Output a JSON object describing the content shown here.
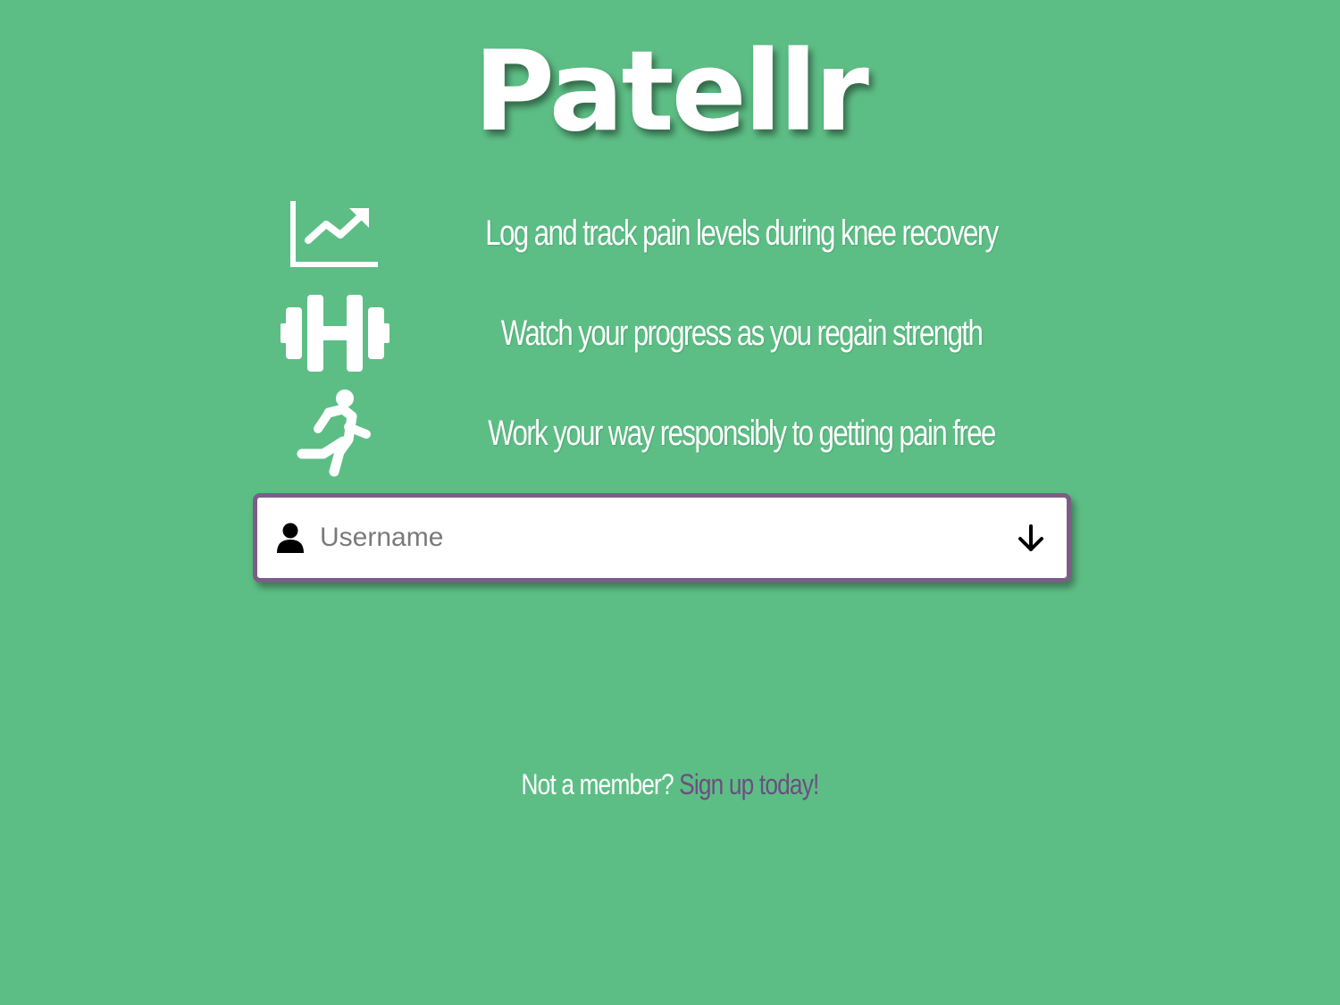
{
  "app": {
    "logo_text": "Patellr"
  },
  "features": [
    {
      "icon": "chart-line-icon",
      "text": "Log and track pain levels during knee recovery"
    },
    {
      "icon": "dumbbell-icon",
      "text": "Watch your progress as you regain strength"
    },
    {
      "icon": "running-person-icon",
      "text": "Work your way responsibly to getting pain free"
    }
  ],
  "login": {
    "username_placeholder": "Username",
    "username_value": "",
    "user_icon": "user-icon",
    "submit_icon": "arrow-down-icon"
  },
  "signup": {
    "prompt": "Not a member?",
    "link_label": "Sign up today!"
  },
  "colors": {
    "background": "#5dbe85",
    "accent": "#7b5e86",
    "link": "#6b4f80",
    "text": "#ffffff"
  }
}
